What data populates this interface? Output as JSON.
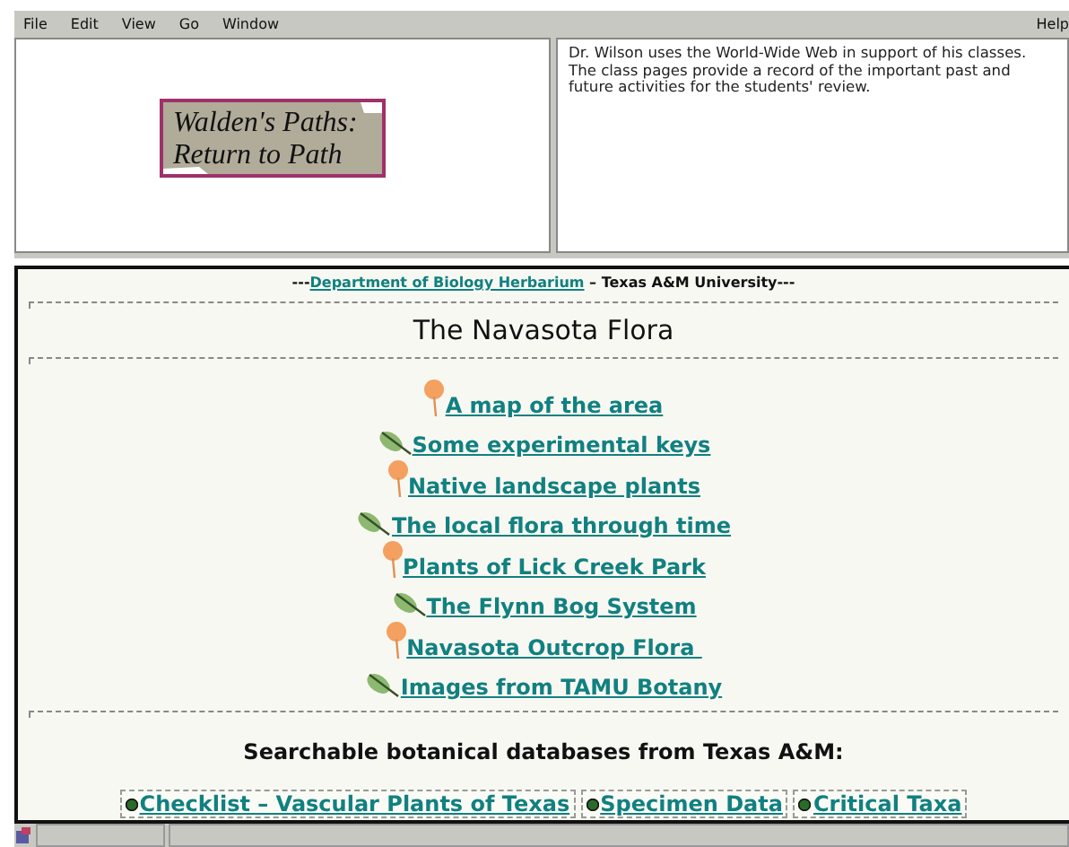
{
  "menu_bar": {
    "items": [
      "File",
      "Edit",
      "View",
      "Go",
      "Window"
    ],
    "help": "Help"
  },
  "logo": {
    "line_1": "Walden's Paths:",
    "line_2": "Return to Path"
  },
  "annotation": "Dr. Wilson uses the World-Wide Web in support of his classes. The class pages provide a record of the important past and future activities for the students' review.",
  "page": {
    "header_prefix": "---",
    "header_link": "Department of Biology Herbarium",
    "header_suffix": " – Texas A&M University---",
    "title": "The Navasota Flora",
    "links": [
      {
        "label": "A map of the area",
        "kind": "flower"
      },
      {
        "label": "Some experimental keys",
        "kind": "leaf"
      },
      {
        "label": "Native landscape plants",
        "kind": "flower"
      },
      {
        "label": "The local flora through time",
        "kind": "leaf"
      },
      {
        "label": "Plants of Lick Creek Park",
        "kind": "flower"
      },
      {
        "label": "The Flynn Bog System",
        "kind": "leaf"
      },
      {
        "label": "Navasota Outcrop Flora ",
        "kind": "flower"
      },
      {
        "label": "Images from TAMU Botany",
        "kind": "leaf"
      }
    ],
    "databases_heading": "Searchable botanical databases from Texas A&M:",
    "databases": [
      "Checklist – Vascular Plants of Texas",
      "Specimen Data",
      "Critical Taxa"
    ]
  }
}
